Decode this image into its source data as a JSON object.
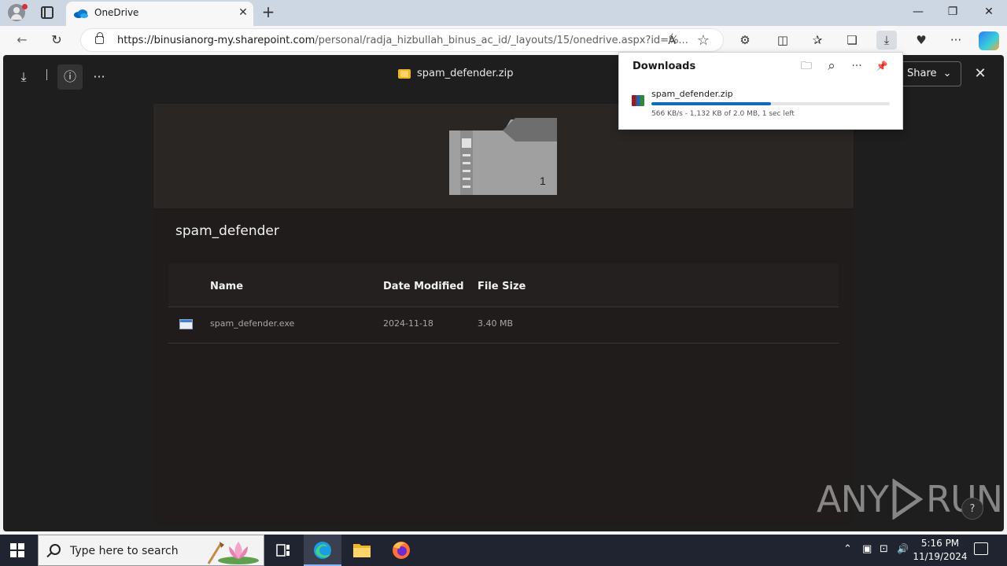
{
  "browser": {
    "tab_title": "OneDrive",
    "tab_close": "✕",
    "new_tab": "+",
    "minimize": "—",
    "restore": "❐",
    "close": "✕",
    "back": "←",
    "refresh": "↻",
    "url_host": "https://binusianorg-my.sharepoint.com",
    "url_path": "/personal/radja_hizbullah_binus_ac_id/_layouts/15/onedrive.aspx?id=%...",
    "read_aloud": "Á",
    "favorite": "☆",
    "extensions": "⚙",
    "split": "◫",
    "favorites": "✰",
    "collections": "❏",
    "downloads": "⤓",
    "performance": "♥",
    "more": "···"
  },
  "viewer": {
    "download_icon": "⤓",
    "info_icon": "ⓘ",
    "more_icon": "···",
    "file_title": "spam_defender.zip",
    "share_label": "Share",
    "share_chevron": "⌄",
    "close_icon": "✕",
    "folder_count": "1",
    "archive_name": "spam_defender",
    "columns": [
      "Name",
      "Date Modified",
      "File Size"
    ],
    "rows": [
      {
        "name": "spam_defender.exe",
        "date": "2024-11-18",
        "size": "3.40 MB"
      }
    ],
    "help": "?"
  },
  "downloads": {
    "title": "Downloads",
    "folder_icon": "🗀",
    "search_icon": "⌕",
    "more_icon": "···",
    "pin_icon": "📌",
    "file_name": "spam_defender.zip",
    "progress": 0.5,
    "status": "566 KB/s - 1,132 KB of 2.0 MB, 1 sec left"
  },
  "watermark": {
    "left": "ANY",
    "right": "RUN"
  },
  "taskbar": {
    "search_placeholder": "Type here to search",
    "time": "5:16 PM",
    "date": "11/19/2024",
    "tray_chevron": "⌃",
    "tray_network": "⊡",
    "tray_volume": "🔊"
  },
  "colors": {
    "accent": "#0f6cbd",
    "viewer_bg": "#1e1e1e",
    "taskbar": "#1f2430"
  }
}
